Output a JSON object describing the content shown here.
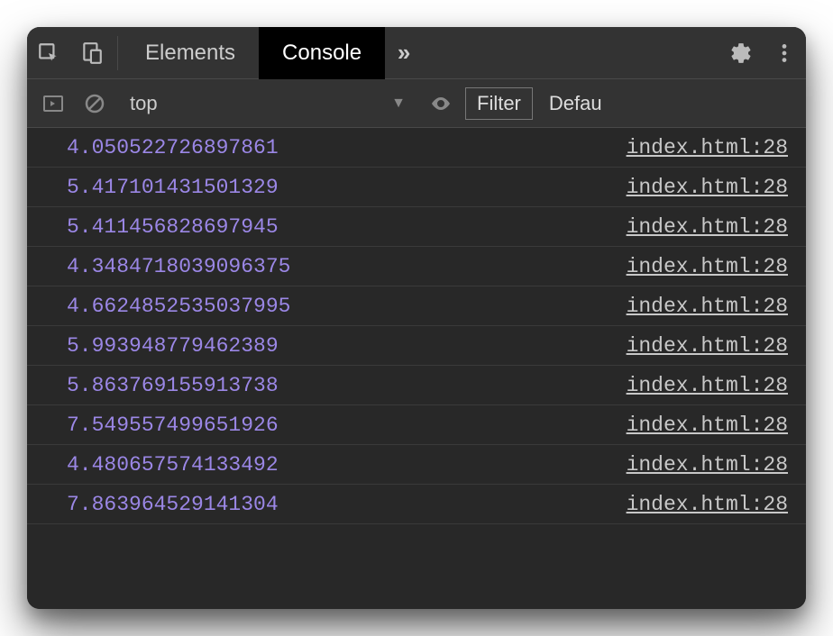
{
  "tabs": {
    "elements": "Elements",
    "console": "Console",
    "overflow": "»"
  },
  "toolbar": {
    "context": "top",
    "filter_label": "Filter",
    "level_label": "Defau"
  },
  "logs": [
    {
      "value": "4.050522726897861",
      "source": "index.html:28"
    },
    {
      "value": "5.417101431501329",
      "source": "index.html:28"
    },
    {
      "value": "5.411456828697945",
      "source": "index.html:28"
    },
    {
      "value": "4.3484718039096375",
      "source": "index.html:28"
    },
    {
      "value": "4.6624852535037995",
      "source": "index.html:28"
    },
    {
      "value": "5.993948779462389",
      "source": "index.html:28"
    },
    {
      "value": "5.863769155913738",
      "source": "index.html:28"
    },
    {
      "value": "7.549557499651926",
      "source": "index.html:28"
    },
    {
      "value": "4.480657574133492",
      "source": "index.html:28"
    },
    {
      "value": "7.863964529141304",
      "source": "index.html:28"
    }
  ]
}
